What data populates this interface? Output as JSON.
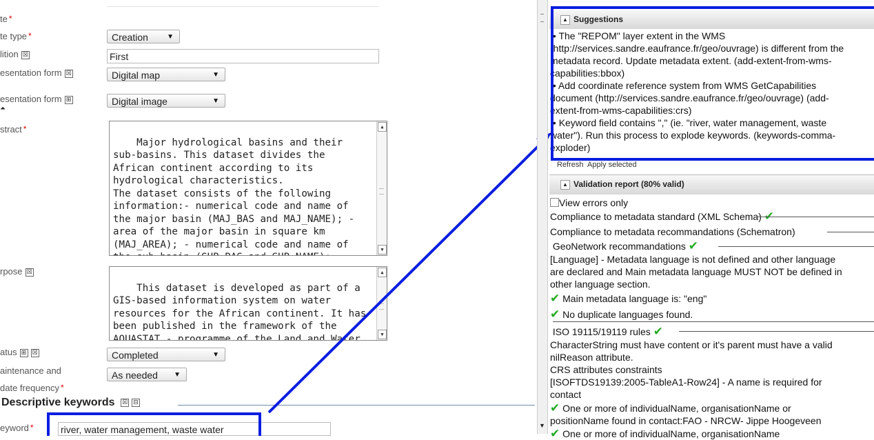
{
  "form": {
    "date_label": "te",
    "date_type_label": "te type",
    "date_type_value": "Creation",
    "edition_label": "lition",
    "edition_value": "First",
    "presentation_form_label": "esentation form",
    "presentation_form_value": "Digital map",
    "presentation_form2_label": "esentation form",
    "presentation_form2_value": "Digital image",
    "abstract_label": "stract",
    "abstract_text": "Major hydrological basins and their sub-basins. This dataset divides the African continent according to its hydrological characteristics.\nThe dataset consists of the following information:- numerical code and name of the major basin (MAJ_BAS and MAJ_NAME); - area of the major basin in square km (MAJ_AREA); - numerical code and name of the sub-basin (SUB_BAS and SUB_NAME); - area of the sub-basin in square km",
    "purpose_label": "rpose",
    "purpose_text": "This dataset is developed as part of a GIS-based information system on water resources for the African continent. It has been published in the framework of the AQUASTAT - programme of the Land and Water Division",
    "status_label": "atus",
    "status_value": "Completed",
    "maintenance_label_1": "aintenance and",
    "maintenance_label_2": "date frequency",
    "maintenance_value": "As needed",
    "keywords_section": "Descriptive keywords",
    "keyword_label": "eyword",
    "keyword_value": "river, water management, waste water"
  },
  "suggestions": {
    "title": "Suggestions",
    "items": [
      [
        "The \"REPOM\" layer extent in the WMS",
        "(http://services.sandre.eaufrance.fr/geo/ouvrage) is different from the",
        "metadata record. Update metadata extent. (add-extent-from-wms-",
        "capabilities:bbox)"
      ],
      [
        "Add coordinate reference system from WMS GetCapabilities",
        "document (http://services.sandre.eaufrance.fr/geo/ouvrage) (add-",
        "extent-from-wms-capabilities:crs)"
      ],
      [
        "Keyword field contains \",\" (ie. \"river, water management, waste",
        "water\"). Run this process to explode keywords. (keywords-comma-",
        "exploder)"
      ]
    ],
    "refresh": "Refresh",
    "apply": "Apply selected"
  },
  "validation": {
    "title": "Validation report (80% valid)",
    "view_errors_only": "View errors only",
    "xml_schema": "Compliance to metadata standard (XML Schema)",
    "schematron": "Compliance to metadata recommandations (Schematron)",
    "geonetwork": "GeoNetwork recommandations",
    "language_error": [
      "[Language] - Metadata language is not defined and other language",
      "are declared and Main metadata language MUST NOT be defined in",
      "other language section."
    ],
    "main_lang": "Main metadata language is: \"eng\"",
    "no_dup": "No duplicate languages found.",
    "iso": "ISO 19115/19119 rules",
    "charstring": [
      "CharacterString must have content or it's parent must have a valid",
      "nilReason attribute."
    ],
    "crs_constraints": "CRS attributes constraints",
    "isoftds": [
      "[ISOFTDS19139:2005-TableA1-Row24] - A name is required for",
      "contact"
    ],
    "one_or_more": [
      "One or more of individualName, organisationName or",
      "positionName found in contact:FAO - NRCW- Jippe Hoogeveen"
    ],
    "one_or_more_cut": "One or more of individualName, organisationName"
  },
  "colors": {
    "highlight": "#0a1ee0",
    "check": "#22aa22"
  }
}
